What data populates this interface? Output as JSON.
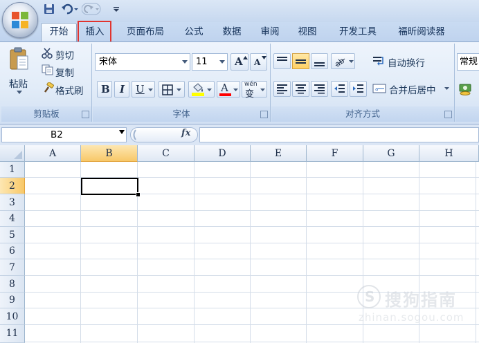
{
  "tabs": [
    {
      "label": "开始",
      "active": true
    },
    {
      "label": "插入",
      "highlighted": true
    },
    {
      "label": "页面布局"
    },
    {
      "label": "公式"
    },
    {
      "label": "数据"
    },
    {
      "label": "审阅"
    },
    {
      "label": "视图"
    },
    {
      "label": "开发工具"
    },
    {
      "label": "福昕阅读器"
    }
  ],
  "clipboard": {
    "paste_label": "粘贴",
    "cut_label": "剪切",
    "copy_label": "复制",
    "format_painter_label": "格式刷",
    "group_label": "剪贴板"
  },
  "font": {
    "font_name": "宋体",
    "font_size": "11",
    "grow_glyph": "A",
    "shrink_glyph": "A",
    "bold_glyph": "B",
    "italic_glyph": "I",
    "underline_glyph": "U",
    "font_color_glyph": "A",
    "phonetic_glyph": "wén",
    "phonetic_char": "变",
    "group_label": "字体"
  },
  "alignment": {
    "wrap_text_label": "自动换行",
    "merge_center_label": "合并后居中",
    "group_label": "对齐方式"
  },
  "number": {
    "format_label": "常规"
  },
  "formula_bar": {
    "name_box": "B2",
    "fx_label": "fx",
    "formula": ""
  },
  "sheet": {
    "columns": [
      "A",
      "B",
      "C",
      "D",
      "E",
      "F",
      "G",
      "H"
    ],
    "rows": [
      "1",
      "2",
      "3",
      "4",
      "5",
      "6",
      "7",
      "8",
      "9",
      "10",
      "11"
    ],
    "active_cell": "B2"
  },
  "watermark": {
    "title": "搜狗指南",
    "url": "zhinan.sogou.com"
  },
  "colors": {
    "highlight_box": "#e1342f",
    "fill_color": "#ffff00",
    "font_color": "#ff0000",
    "selected_header": "#f8c868"
  }
}
